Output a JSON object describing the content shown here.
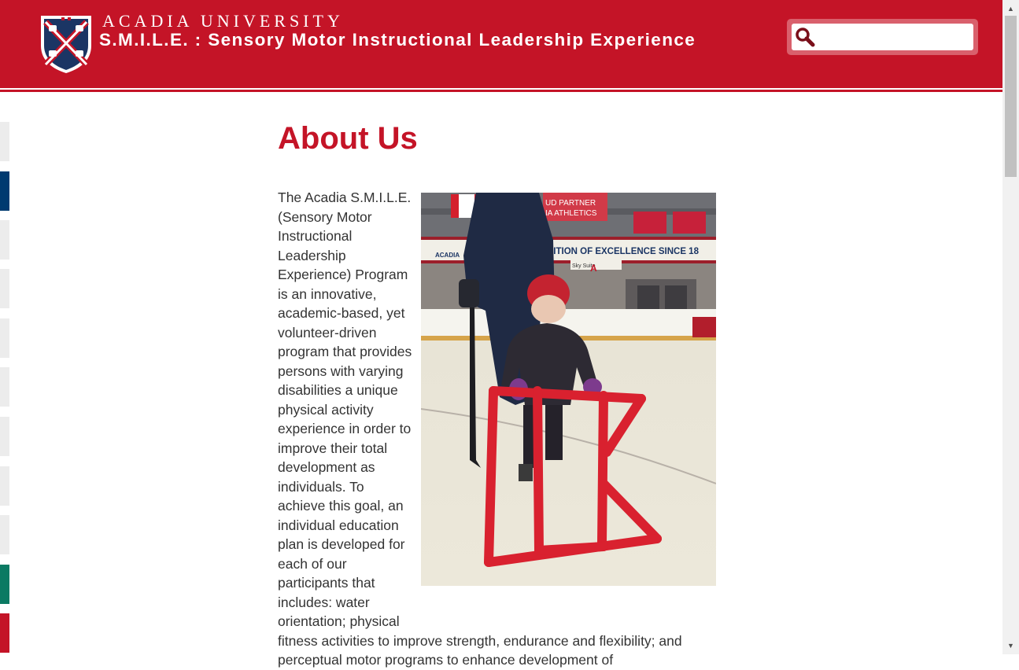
{
  "header": {
    "university": "ACADIA UNIVERSITY",
    "program_title": "S.M.I.L.E. : Sensory Motor Instructional Leadership Experience",
    "search": {
      "placeholder": ""
    }
  },
  "side_tabs": [
    {
      "color": "#ececec"
    },
    {
      "color": "#003a70"
    },
    {
      "color": "#ececec"
    },
    {
      "color": "#ececec"
    },
    {
      "color": "#ececec"
    },
    {
      "color": "#ececec"
    },
    {
      "color": "#ececec"
    },
    {
      "color": "#ececec"
    },
    {
      "color": "#ececec"
    },
    {
      "color": "#0b7a63"
    },
    {
      "color": "#c41427"
    }
  ],
  "main": {
    "title": "About Us",
    "paragraph": "The Acadia S.M.I.L.E. (Sensory Motor Instructional Leadership Experience) Program is an innovative, academic-based, yet volunteer-driven program that provides persons with varying disabilities a unique physical activity experience in order to improve their total development as individuals. To achieve this goal, an individual education plan is developed for each of our participants that includes: water orientation; physical fitness activities to improve strength, endurance and flexibility; and perceptual motor programs to enhance development of"
  },
  "photo_signage": {
    "banner_top": "UD PARTNER\nIA ATHLETICS",
    "banner_main": "DITION OF EXCELLENCE SINCE 18",
    "acadia": "ACADIA",
    "sky": "Sky Suite",
    "letter": "A"
  },
  "colors": {
    "brand_red": "#c41427",
    "title_red": "#c41427",
    "text": "#333333"
  }
}
